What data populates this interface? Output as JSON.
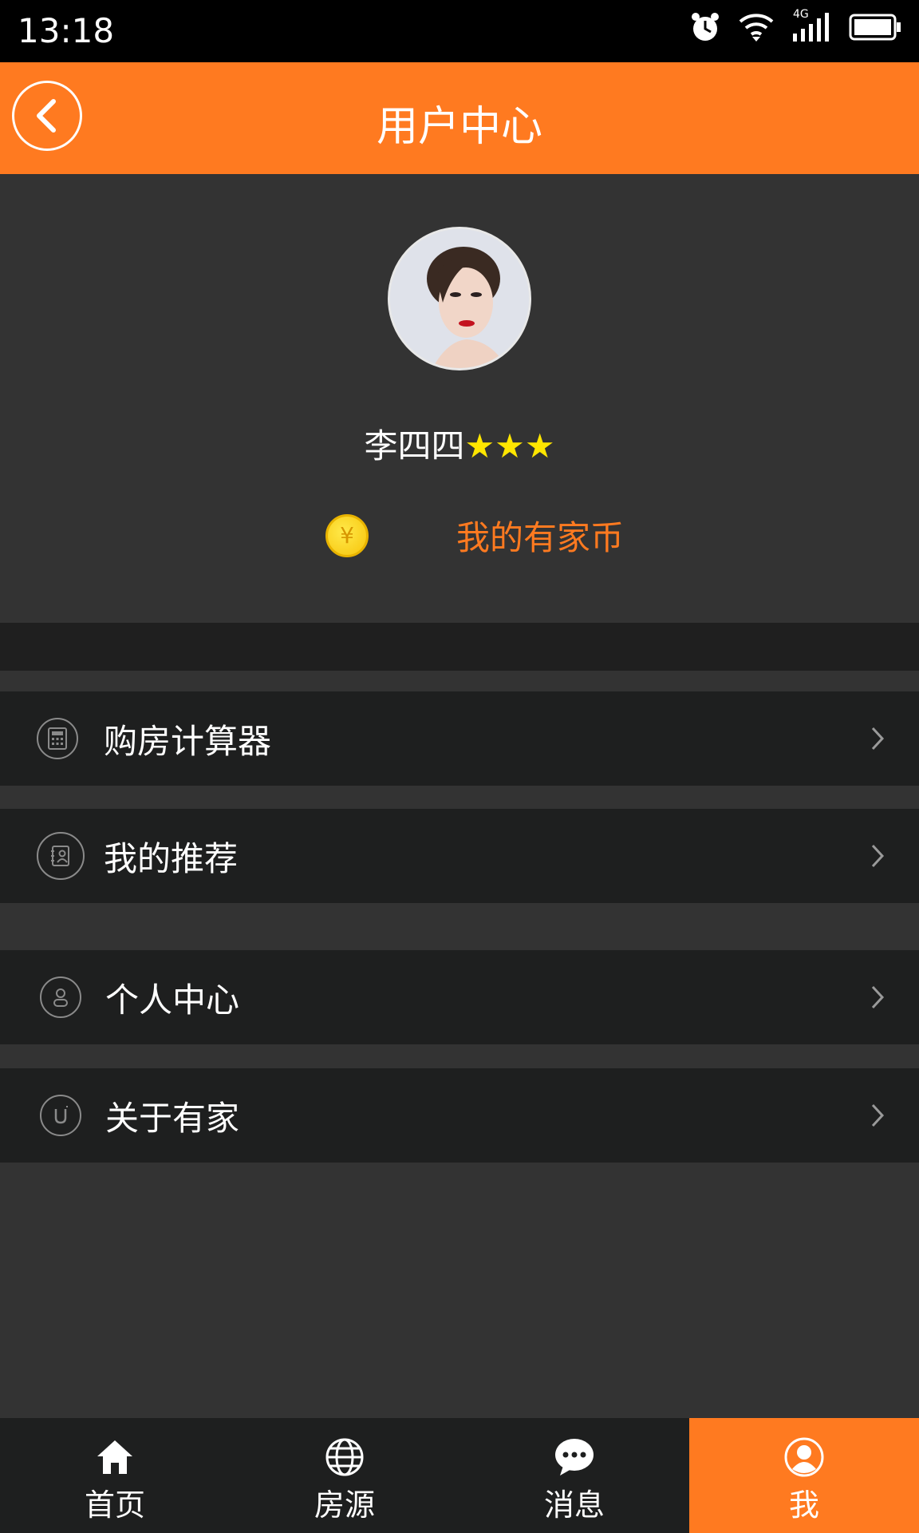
{
  "status_bar": {
    "time": "13:18",
    "network": "4G"
  },
  "header": {
    "title": "用户中心"
  },
  "profile": {
    "name": "李四四",
    "stars": "★★★",
    "coins_label": "我的有家币",
    "coin_symbol": "¥"
  },
  "menu": {
    "items": [
      {
        "label": "购房计算器",
        "icon": "calculator-icon"
      },
      {
        "label": "我的推荐",
        "icon": "contact-book-icon"
      },
      {
        "label": "个人中心",
        "icon": "user-icon"
      },
      {
        "label": "关于有家",
        "icon": "u-logo-icon"
      }
    ]
  },
  "bottom_nav": {
    "items": [
      {
        "label": "首页",
        "icon": "home-icon"
      },
      {
        "label": "房源",
        "icon": "globe-icon"
      },
      {
        "label": "消息",
        "icon": "chat-icon"
      },
      {
        "label": "我",
        "icon": "user-icon",
        "active": true
      }
    ]
  },
  "colors": {
    "accent": "#FF7A20",
    "background": "#333333",
    "panel": "#1E1F1F",
    "star": "#FFE600"
  }
}
